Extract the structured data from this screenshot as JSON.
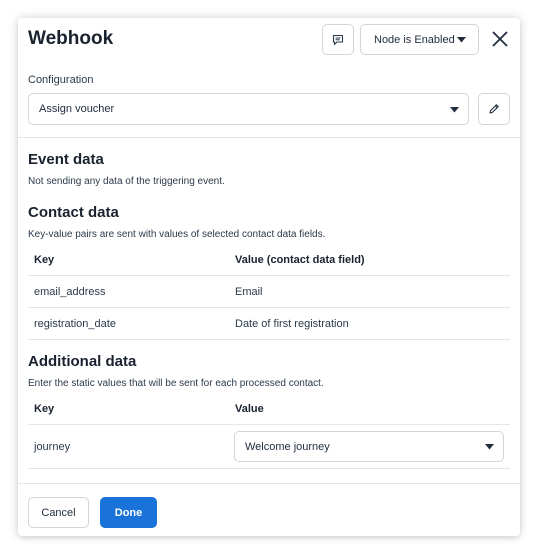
{
  "dialog": {
    "title": "Webhook",
    "comment_icon": "comment-icon",
    "node_status": "Node is Enabled",
    "close_icon": "close-icon"
  },
  "config": {
    "label": "Configuration",
    "selected": "Assign voucher",
    "edit_icon": "pencil-icon"
  },
  "event_data": {
    "title": "Event data",
    "description": "Not sending any data of the triggering event."
  },
  "contact_data": {
    "title": "Contact data",
    "description": "Key-value pairs are sent with values of selected contact data fields.",
    "headers": [
      "Key",
      "Value (contact data field)"
    ],
    "rows": [
      [
        "email_address",
        "Email"
      ],
      [
        "registration_date",
        "Date of first registration"
      ]
    ]
  },
  "additional_data": {
    "title": "Additional data",
    "description": "Enter the static values that will be sent for each processed contact.",
    "headers": [
      "Key",
      "Value"
    ],
    "rows": [
      {
        "key": "journey",
        "value": "Welcome journey"
      }
    ]
  },
  "footer": {
    "cancel_label": "Cancel",
    "done_label": "Done"
  },
  "colors": {
    "primary": "#1a73d9",
    "border": "#d2d6dc",
    "text": "#1f2d3d"
  }
}
